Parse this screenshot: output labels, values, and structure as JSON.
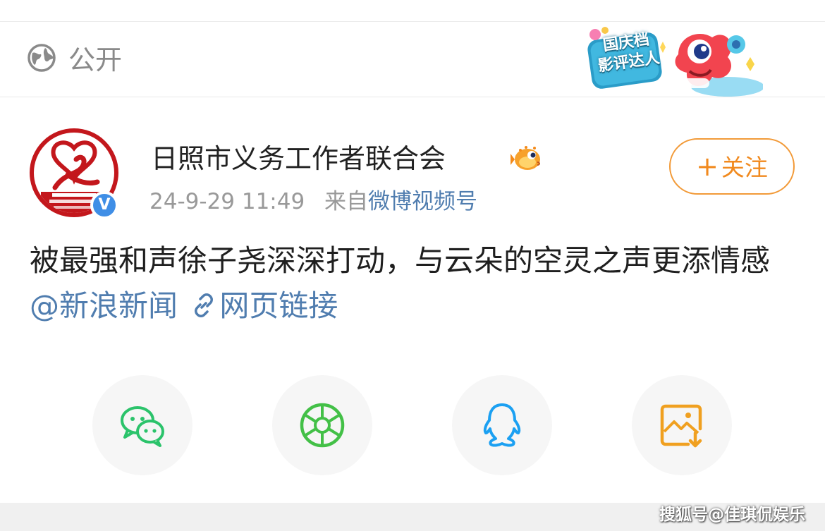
{
  "visibility": {
    "icon": "globe-icon",
    "label": "公开"
  },
  "badge": {
    "text": "国庆档\n影评达人",
    "icon": "mascot-badge"
  },
  "post": {
    "author": {
      "name": "日照市义务工作者联合会",
      "avatar_icon": "organization-logo",
      "verified_icon": "verified-badge-icon",
      "verified_mark": "V",
      "vip_icon": "pufferfish-icon"
    },
    "meta": {
      "timestamp": "24-9-29 11:49",
      "source_prefix": "来自",
      "source": "微博视频号"
    },
    "follow_button": {
      "plus": "+",
      "label": "关注"
    },
    "text": {
      "body": "被最强和声徐子尧深深打动，与云朵的空灵之声更添情感",
      "mention": "@新浪新闻",
      "link_icon": "link-icon",
      "link_label": "网页链接"
    }
  },
  "share": {
    "buttons": [
      {
        "name": "wechat",
        "icon": "wechat-icon",
        "color": "#2bc36b"
      },
      {
        "name": "moments",
        "icon": "moments-icon",
        "color": "#43c047"
      },
      {
        "name": "qq",
        "icon": "qq-icon",
        "color": "#1ba0f2"
      },
      {
        "name": "save-image",
        "icon": "save-image-icon",
        "color": "#f0a020"
      }
    ]
  },
  "watermark": "搜狐号@佳琪侃娱乐"
}
